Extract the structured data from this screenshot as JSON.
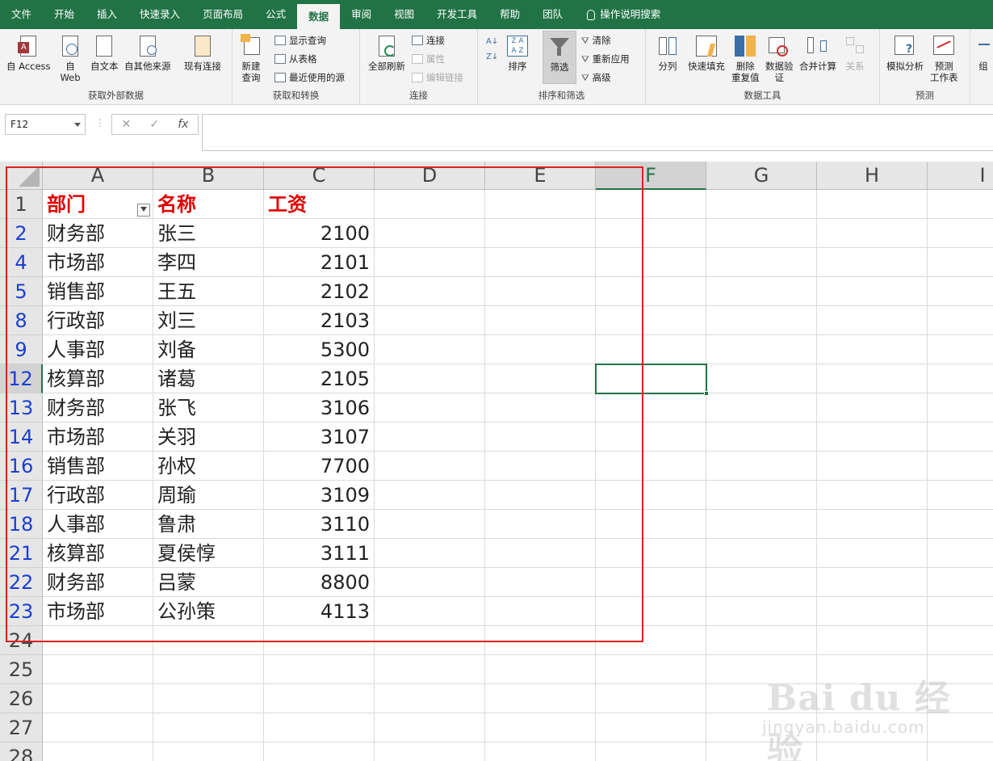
{
  "tabs": [
    "文件",
    "开始",
    "插入",
    "快速录入",
    "页面布局",
    "公式",
    "数据",
    "审阅",
    "视图",
    "开发工具",
    "帮助",
    "团队"
  ],
  "active_tab_index": 6,
  "search_label": "操作说明搜索",
  "ribbon": {
    "get_external": {
      "access": "自 Access",
      "web_1": "自",
      "web_2": "Web",
      "text": "自文本",
      "other": "自其他来源",
      "existing": "现有连接",
      "label": "获取外部数据"
    },
    "get_transform": {
      "new_query_1": "新建",
      "new_query_2": "查询",
      "show_query": "显示查询",
      "from_table": "从表格",
      "recent": "最近使用的源",
      "label": "获取和转换"
    },
    "connections": {
      "refresh_all": "全部刷新",
      "connections": "连接",
      "properties": "属性",
      "edit_links": "编辑链接",
      "label": "连接"
    },
    "sort_filter": {
      "sort": "排序",
      "filter": "筛选",
      "clear": "清除",
      "reapply": "重新应用",
      "advanced": "高级",
      "label": "排序和筛选"
    },
    "data_tools": {
      "split": "分列",
      "flash_fill": "快速填充",
      "remove_dup_1": "删除",
      "remove_dup_2": "重复值",
      "validation_1": "数据验",
      "validation_2": "证",
      "consolidate": "合并计算",
      "relations": "关系",
      "label": "数据工具"
    },
    "forecast": {
      "whatif": "模拟分析",
      "sheet_1": "预测",
      "sheet_2": "工作表",
      "label": "预测"
    },
    "outline_partial": "组"
  },
  "formula_bar": {
    "name_box": "F12",
    "cancel": "✕",
    "enter": "✓",
    "fx": "fx",
    "formula": ""
  },
  "columns": [
    "A",
    "B",
    "C",
    "D",
    "E",
    "F",
    "G",
    "H",
    "I"
  ],
  "selected_column": "F",
  "selected_row": "12",
  "rows": [
    {
      "num": "1",
      "filtered": false,
      "a": "部门",
      "b": "名称",
      "c": "工资",
      "header": true
    },
    {
      "num": "2",
      "filtered": true,
      "a": "财务部",
      "b": "张三",
      "c": "2100"
    },
    {
      "num": "4",
      "filtered": true,
      "a": "市场部",
      "b": "李四",
      "c": "2101"
    },
    {
      "num": "5",
      "filtered": true,
      "a": "销售部",
      "b": "王五",
      "c": "2102"
    },
    {
      "num": "8",
      "filtered": true,
      "a": "行政部",
      "b": "刘三",
      "c": "2103"
    },
    {
      "num": "9",
      "filtered": true,
      "a": "人事部",
      "b": "刘备",
      "c": "5300"
    },
    {
      "num": "12",
      "filtered": true,
      "a": "核算部",
      "b": "诸葛",
      "c": "2105"
    },
    {
      "num": "13",
      "filtered": true,
      "a": "财务部",
      "b": "张飞",
      "c": "3106"
    },
    {
      "num": "14",
      "filtered": true,
      "a": "市场部",
      "b": "关羽",
      "c": "3107"
    },
    {
      "num": "16",
      "filtered": true,
      "a": "销售部",
      "b": "孙权",
      "c": "7700"
    },
    {
      "num": "17",
      "filtered": true,
      "a": "行政部",
      "b": "周瑜",
      "c": "3109"
    },
    {
      "num": "18",
      "filtered": true,
      "a": "人事部",
      "b": "鲁肃",
      "c": "3110"
    },
    {
      "num": "21",
      "filtered": true,
      "a": "核算部",
      "b": "夏侯惇",
      "c": "3111"
    },
    {
      "num": "22",
      "filtered": true,
      "a": "财务部",
      "b": "吕蒙",
      "c": "8800"
    },
    {
      "num": "23",
      "filtered": true,
      "a": "市场部",
      "b": "公孙策",
      "c": "4113"
    },
    {
      "num": "24",
      "filtered": false,
      "a": "",
      "b": "",
      "c": ""
    },
    {
      "num": "25",
      "filtered": false,
      "a": "",
      "b": "",
      "c": ""
    },
    {
      "num": "26",
      "filtered": false,
      "a": "",
      "b": "",
      "c": ""
    },
    {
      "num": "27",
      "filtered": false,
      "a": "",
      "b": "",
      "c": ""
    },
    {
      "num": "28",
      "filtered": false,
      "a": "",
      "b": "",
      "c": ""
    }
  ],
  "watermark": {
    "main": "Bai du 经验",
    "sub": "jingyan.baidu.com"
  },
  "colors": {
    "accent": "#217346",
    "header_text": "#e00000",
    "filtered_row": "#1a3fd3",
    "highlight_box": "#e02020"
  }
}
